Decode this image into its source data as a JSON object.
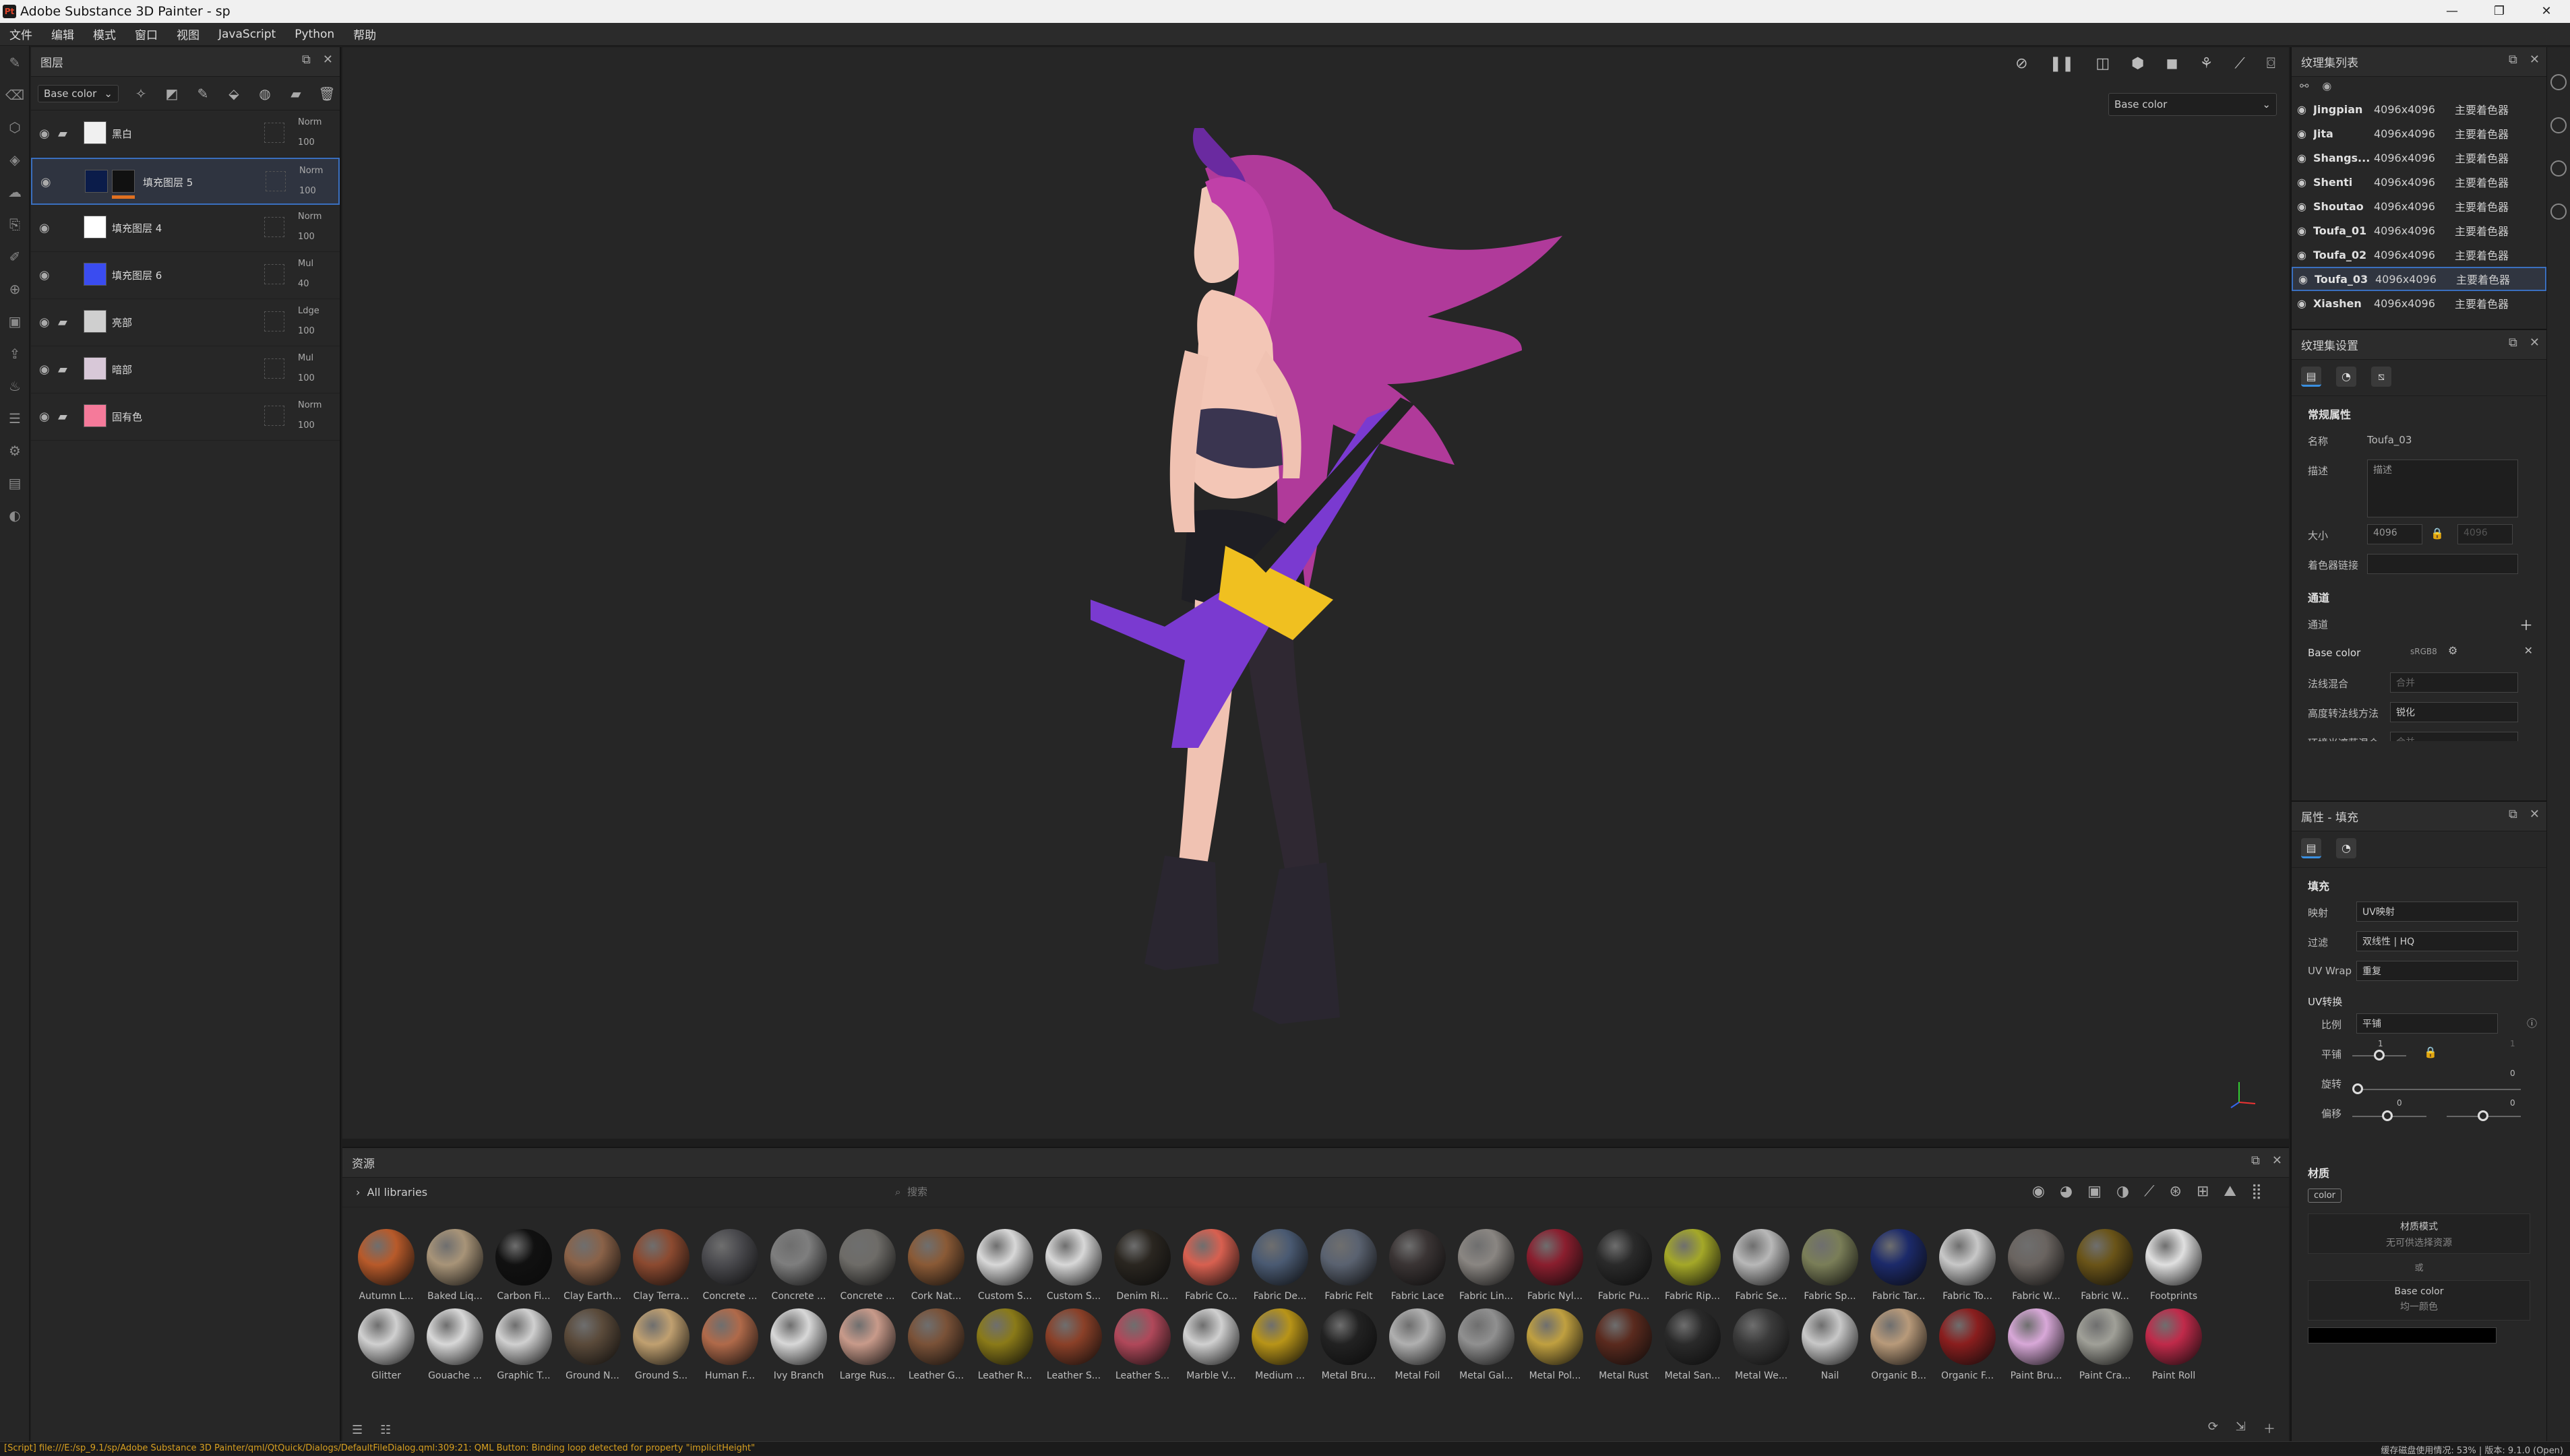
{
  "window": {
    "title": "Adobe Substance 3D Painter - sp",
    "min": "—",
    "max": "❐",
    "close": "✕"
  },
  "menu": [
    "文件",
    "编辑",
    "模式",
    "窗口",
    "视图",
    "JavaScript",
    "Python",
    "帮助"
  ],
  "layers": {
    "panel_title": "图层",
    "channel_select": "Base color",
    "rows": [
      {
        "name": "黑白",
        "blend": "Norm",
        "opacity": "100",
        "thumb": "#f0f0f0",
        "folder": true
      },
      {
        "name": "填充图层 5",
        "blend": "Norm",
        "opacity": "100",
        "thumb": "#0b1c4a",
        "folder": false,
        "active": true
      },
      {
        "name": "填充图层 4",
        "blend": "Norm",
        "opacity": "100",
        "thumb": "#ffffff",
        "folder": false
      },
      {
        "name": "填充图层 6",
        "blend": "Mul",
        "opacity": "40",
        "thumb": "#3a4cf0",
        "folder": false
      },
      {
        "name": "亮部",
        "blend": "Ldge",
        "opacity": "100",
        "thumb": "#cfcfcf",
        "folder": true
      },
      {
        "name": "暗部",
        "blend": "Mul",
        "opacity": "100",
        "thumb": "#d8c8d8",
        "folder": true
      },
      {
        "name": "固有色",
        "blend": "Norm",
        "opacity": "100",
        "thumb": "#f57a9a",
        "folder": true
      }
    ]
  },
  "viewport": {
    "channel_select": "Base color"
  },
  "assets": {
    "panel_title": "资源",
    "library": "All libraries",
    "search_placeholder": "搜索",
    "row1": [
      {
        "label": "Autumn L...",
        "color": "#b85a2a"
      },
      {
        "label": "Baked Liq...",
        "color": "#a89478"
      },
      {
        "label": "Carbon Fi...",
        "color": "#111111"
      },
      {
        "label": "Clay Earth...",
        "color": "#8a6248"
      },
      {
        "label": "Clay Terra...",
        "color": "#8c4a30"
      },
      {
        "label": "Concrete ...",
        "color": "#4a4a4e"
      },
      {
        "label": "Concrete ...",
        "color": "#7e7e7e"
      },
      {
        "label": "Concrete ...",
        "color": "#6e6c68"
      },
      {
        "label": "Cork Nat...",
        "color": "#8a5a36"
      },
      {
        "label": "Custom S...",
        "color": "#d8d8d8"
      },
      {
        "label": "Custom S...",
        "color": "#d8d8d8"
      },
      {
        "label": "Denim Ri...",
        "color": "#2a2620"
      },
      {
        "label": "Fabric Co...",
        "color": "#d86050"
      },
      {
        "label": "Fabric De...",
        "color": "#4a5a72"
      },
      {
        "label": "Fabric Felt",
        "color": "#5a6270"
      },
      {
        "label": "Fabric Lace",
        "color": "#3a3434"
      },
      {
        "label": "Fabric Lin...",
        "color": "#8a8682"
      },
      {
        "label": "Fabric Nyl...",
        "color": "#8a1e2e"
      },
      {
        "label": "Fabric Pu...",
        "color": "#2a2a2a"
      },
      {
        "label": "Fabric Rip...",
        "color": "#a4a828"
      },
      {
        "label": "Fabric Se...",
        "color": "#b8b8b8"
      },
      {
        "label": "Fabric Sp...",
        "color": "#7a7e58"
      },
      {
        "label": "Fabric Tar...",
        "color": "#1c2a6a"
      },
      {
        "label": "Fabric To...",
        "color": "#c8c8c8"
      },
      {
        "label": "Fabric W...",
        "color": "#6a6460"
      },
      {
        "label": "Fabric W...",
        "color": "#6a5418"
      },
      {
        "label": "Footprints",
        "color": "#e0e0e0"
      }
    ],
    "row2": [
      {
        "label": "Glitter",
        "color": "#d0d0d0"
      },
      {
        "label": "Gouache ...",
        "color": "#d8d8d8"
      },
      {
        "label": "Graphic T...",
        "color": "#d0d0d0"
      },
      {
        "label": "Ground N...",
        "color": "#5a4a3a"
      },
      {
        "label": "Ground S...",
        "color": "#c0a070"
      },
      {
        "label": "Human F...",
        "color": "#b06a4a"
      },
      {
        "label": "Ivy Branch",
        "color": "#d8d8d8"
      },
      {
        "label": "Large Rus...",
        "color": "#c89a8a"
      },
      {
        "label": "Leather G...",
        "color": "#7a5238"
      },
      {
        "label": "Leather R...",
        "color": "#8a7a18"
      },
      {
        "label": "Leather S...",
        "color": "#8a4028"
      },
      {
        "label": "Leather S...",
        "color": "#b0485a"
      },
      {
        "label": "Marble V...",
        "color": "#d0d0d0"
      },
      {
        "label": "Medium ...",
        "color": "#b89418"
      },
      {
        "label": "Metal Bru...",
        "color": "#222222"
      },
      {
        "label": "Metal Foil",
        "color": "#b0b0b0"
      },
      {
        "label": "Metal Gal...",
        "color": "#909090"
      },
      {
        "label": "Metal Pol...",
        "color": "#c0a040"
      },
      {
        "label": "Metal Rust",
        "color": "#5a2a1e"
      },
      {
        "label": "Metal San...",
        "color": "#2a2a2a"
      },
      {
        "label": "Metal We...",
        "color": "#3a3a3a"
      },
      {
        "label": "Nail",
        "color": "#c8c8c8"
      },
      {
        "label": "Organic B...",
        "color": "#b89a7a"
      },
      {
        "label": "Organic F...",
        "color": "#8a1e1e"
      },
      {
        "label": "Paint Bru...",
        "color": "#d8a8d8"
      },
      {
        "label": "Paint Cra...",
        "color": "#a0a098"
      },
      {
        "label": "Paint Roll",
        "color": "#c02a4a"
      }
    ]
  },
  "texture_sets": {
    "panel_title": "纹理集列表",
    "rows": [
      {
        "name": "Jingpian",
        "size": "4096x4096",
        "shader": "主要着色器"
      },
      {
        "name": "Jita",
        "size": "4096x4096",
        "shader": "主要着色器"
      },
      {
        "name": "Shangs...",
        "size": "4096x4096",
        "shader": "主要着色器"
      },
      {
        "name": "Shenti",
        "size": "4096x4096",
        "shader": "主要着色器"
      },
      {
        "name": "Shoutao",
        "size": "4096x4096",
        "shader": "主要着色器"
      },
      {
        "name": "Toufa_01",
        "size": "4096x4096",
        "shader": "主要着色器"
      },
      {
        "name": "Toufa_02",
        "size": "4096x4096",
        "shader": "主要着色器"
      },
      {
        "name": "Toufa_03",
        "size": "4096x4096",
        "shader": "主要着色器",
        "active": true
      },
      {
        "name": "Xiashen",
        "size": "4096x4096",
        "shader": "主要着色器"
      }
    ]
  },
  "texture_set_settings": {
    "panel_title": "纹理集设置",
    "general": "常规属性",
    "name_label": "名称",
    "name_value": "Toufa_03",
    "desc_label": "描述",
    "desc_placeholder": "描述",
    "size_label": "大小",
    "size_value": "4096",
    "size_value2": "4096",
    "shader_label": "着色器链接",
    "channels_section": "通道",
    "channels_label": "通道",
    "channel_name": "Base color",
    "channel_format": "sRGB8",
    "normal_mix_label": "法线混合",
    "normal_mix_value": "合并",
    "height_to_normal_label": "高度转法线方法",
    "height_to_normal_value": "锐化",
    "ao_mix_label": "环境光遮蔽混合",
    "ao_mix_value": "合并"
  },
  "properties": {
    "panel_title": "属性 - 填充",
    "fill_section": "填充",
    "mapping_label": "映射",
    "mapping_value": "UV映射",
    "filter_label": "过滤",
    "filter_value": "双线性 | HQ",
    "uvwrap_label": "UV Wrap",
    "uvwrap_value": "重复",
    "uvtransform": "UV转换",
    "scale_label": "比例",
    "scale_value": "平铺",
    "tile_label": "平铺",
    "tile_val1": "1",
    "tile_val2": "1",
    "rotate_label": "旋转",
    "rotate_val": "0",
    "offset_label": "偏移",
    "offset_val1": "0",
    "offset_val2": "0",
    "material_section": "材质",
    "color_tag": "color",
    "material_mode": "材质模式",
    "material_mode_sub": "无可供选择资源",
    "or": "或",
    "base_color": "Base color",
    "base_color_sub": "均一颜色"
  },
  "status": {
    "message": "[Script] file:///E:/sp_9.1/sp/Adobe Substance 3D Painter/qml/QtQuick/Dialogs/DefaultFileDialog.qml:309:21: QML Button: Binding loop detected for property \"implicitHeight\"",
    "right": "缓存磁盘使用情况:   53%  |  版本: 9.1.0 (Open)"
  }
}
